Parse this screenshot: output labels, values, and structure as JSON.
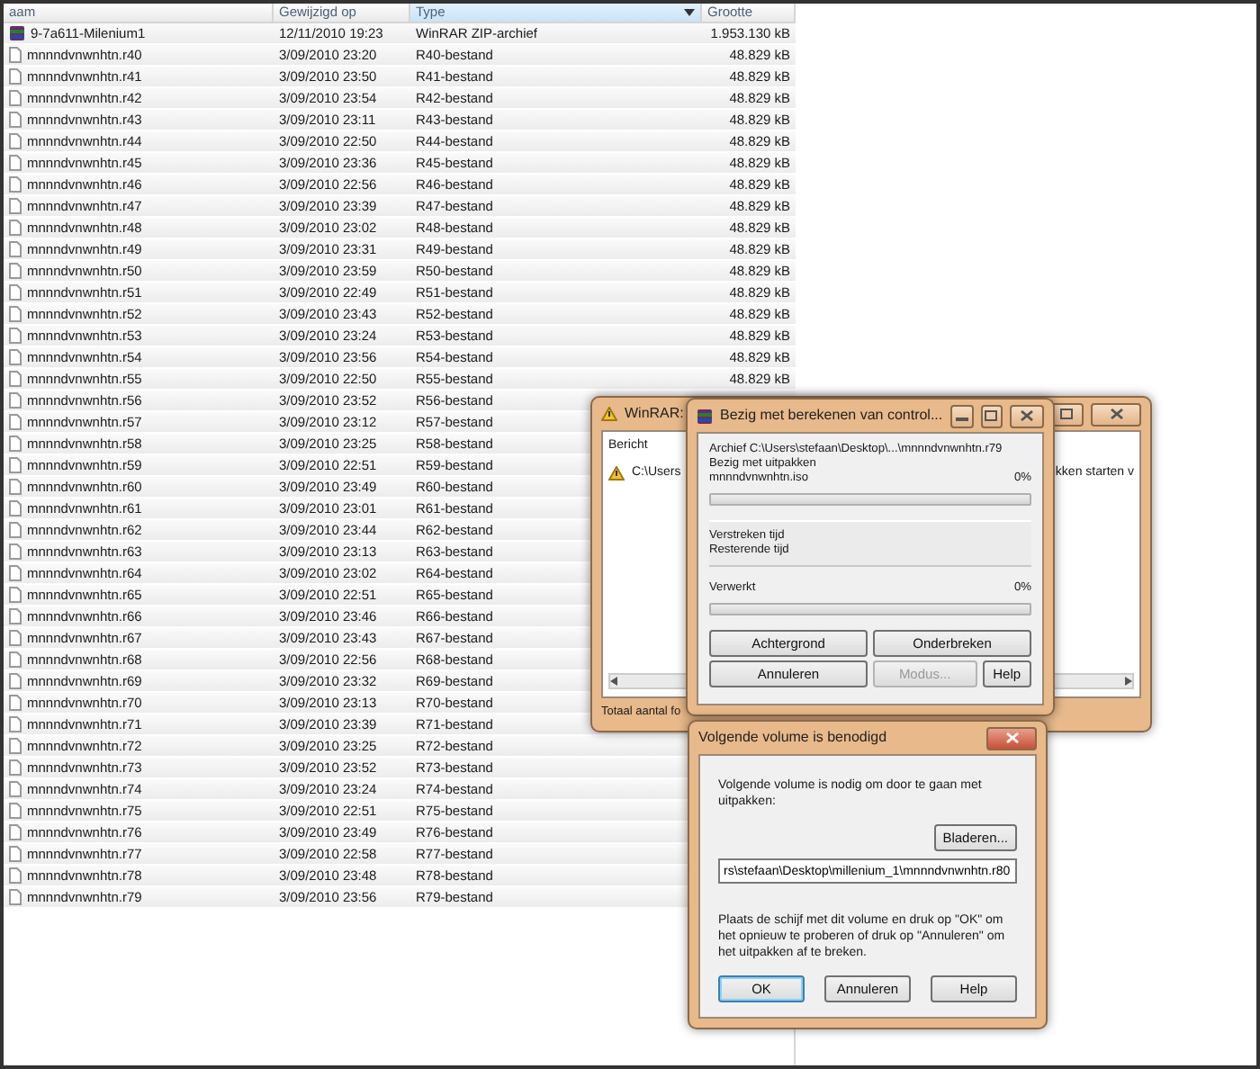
{
  "file_list": {
    "columns": [
      {
        "label": "aam",
        "sorted": false
      },
      {
        "label": "Gewijzigd op",
        "sorted": false
      },
      {
        "label": "Type",
        "sorted": true
      },
      {
        "label": "Grootte",
        "sorted": false
      }
    ],
    "rows": [
      {
        "kind": "archive",
        "name": "9-7a611-Milenium1",
        "modified": "12/11/2010 19:23",
        "type": "WinRAR ZIP-archief",
        "size": "1.953.130 kB"
      },
      {
        "kind": "file",
        "name": "mnnndvnwnhtn.r40",
        "modified": "3/09/2010 23:20",
        "type": "R40-bestand",
        "size": "48.829 kB"
      },
      {
        "kind": "file",
        "name": "mnnndvnwnhtn.r41",
        "modified": "3/09/2010 23:50",
        "type": "R41-bestand",
        "size": "48.829 kB"
      },
      {
        "kind": "file",
        "name": "mnnndvnwnhtn.r42",
        "modified": "3/09/2010 23:54",
        "type": "R42-bestand",
        "size": "48.829 kB"
      },
      {
        "kind": "file",
        "name": "mnnndvnwnhtn.r43",
        "modified": "3/09/2010 23:11",
        "type": "R43-bestand",
        "size": "48.829 kB"
      },
      {
        "kind": "file",
        "name": "mnnndvnwnhtn.r44",
        "modified": "3/09/2010 22:50",
        "type": "R44-bestand",
        "size": "48.829 kB"
      },
      {
        "kind": "file",
        "name": "mnnndvnwnhtn.r45",
        "modified": "3/09/2010 23:36",
        "type": "R45-bestand",
        "size": "48.829 kB"
      },
      {
        "kind": "file",
        "name": "mnnndvnwnhtn.r46",
        "modified": "3/09/2010 22:56",
        "type": "R46-bestand",
        "size": "48.829 kB"
      },
      {
        "kind": "file",
        "name": "mnnndvnwnhtn.r47",
        "modified": "3/09/2010 23:39",
        "type": "R47-bestand",
        "size": "48.829 kB"
      },
      {
        "kind": "file",
        "name": "mnnndvnwnhtn.r48",
        "modified": "3/09/2010 23:02",
        "type": "R48-bestand",
        "size": "48.829 kB"
      },
      {
        "kind": "file",
        "name": "mnnndvnwnhtn.r49",
        "modified": "3/09/2010 23:31",
        "type": "R49-bestand",
        "size": "48.829 kB"
      },
      {
        "kind": "file",
        "name": "mnnndvnwnhtn.r50",
        "modified": "3/09/2010 23:59",
        "type": "R50-bestand",
        "size": "48.829 kB"
      },
      {
        "kind": "file",
        "name": "mnnndvnwnhtn.r51",
        "modified": "3/09/2010 22:49",
        "type": "R51-bestand",
        "size": "48.829 kB"
      },
      {
        "kind": "file",
        "name": "mnnndvnwnhtn.r52",
        "modified": "3/09/2010 23:43",
        "type": "R52-bestand",
        "size": "48.829 kB"
      },
      {
        "kind": "file",
        "name": "mnnndvnwnhtn.r53",
        "modified": "3/09/2010 23:24",
        "type": "R53-bestand",
        "size": "48.829 kB"
      },
      {
        "kind": "file",
        "name": "mnnndvnwnhtn.r54",
        "modified": "3/09/2010 23:56",
        "type": "R54-bestand",
        "size": "48.829 kB"
      },
      {
        "kind": "file",
        "name": "mnnndvnwnhtn.r55",
        "modified": "3/09/2010 22:50",
        "type": "R55-bestand",
        "size": "48.829 kB"
      },
      {
        "kind": "file",
        "name": "mnnndvnwnhtn.r56",
        "modified": "3/09/2010 23:52",
        "type": "R56-bestand"
      },
      {
        "kind": "file",
        "name": "mnnndvnwnhtn.r57",
        "modified": "3/09/2010 23:12",
        "type": "R57-bestand"
      },
      {
        "kind": "file",
        "name": "mnnndvnwnhtn.r58",
        "modified": "3/09/2010 23:25",
        "type": "R58-bestand"
      },
      {
        "kind": "file",
        "name": "mnnndvnwnhtn.r59",
        "modified": "3/09/2010 22:51",
        "type": "R59-bestand"
      },
      {
        "kind": "file",
        "name": "mnnndvnwnhtn.r60",
        "modified": "3/09/2010 23:49",
        "type": "R60-bestand"
      },
      {
        "kind": "file",
        "name": "mnnndvnwnhtn.r61",
        "modified": "3/09/2010 23:01",
        "type": "R61-bestand"
      },
      {
        "kind": "file",
        "name": "mnnndvnwnhtn.r62",
        "modified": "3/09/2010 23:44",
        "type": "R62-bestand"
      },
      {
        "kind": "file",
        "name": "mnnndvnwnhtn.r63",
        "modified": "3/09/2010 23:13",
        "type": "R63-bestand"
      },
      {
        "kind": "file",
        "name": "mnnndvnwnhtn.r64",
        "modified": "3/09/2010 23:02",
        "type": "R64-bestand"
      },
      {
        "kind": "file",
        "name": "mnnndvnwnhtn.r65",
        "modified": "3/09/2010 22:51",
        "type": "R65-bestand"
      },
      {
        "kind": "file",
        "name": "mnnndvnwnhtn.r66",
        "modified": "3/09/2010 23:46",
        "type": "R66-bestand"
      },
      {
        "kind": "file",
        "name": "mnnndvnwnhtn.r67",
        "modified": "3/09/2010 23:43",
        "type": "R67-bestand"
      },
      {
        "kind": "file",
        "name": "mnnndvnwnhtn.r68",
        "modified": "3/09/2010 22:56",
        "type": "R68-bestand"
      },
      {
        "kind": "file",
        "name": "mnnndvnwnhtn.r69",
        "modified": "3/09/2010 23:32",
        "type": "R69-bestand"
      },
      {
        "kind": "file",
        "name": "mnnndvnwnhtn.r70",
        "modified": "3/09/2010 23:13",
        "type": "R70-bestand"
      },
      {
        "kind": "file",
        "name": "mnnndvnwnhtn.r71",
        "modified": "3/09/2010 23:39",
        "type": "R71-bestand"
      },
      {
        "kind": "file",
        "name": "mnnndvnwnhtn.r72",
        "modified": "3/09/2010 23:25",
        "type": "R72-bestand"
      },
      {
        "kind": "file",
        "name": "mnnndvnwnhtn.r73",
        "modified": "3/09/2010 23:52",
        "type": "R73-bestand"
      },
      {
        "kind": "file",
        "name": "mnnndvnwnhtn.r74",
        "modified": "3/09/2010 23:24",
        "type": "R74-bestand"
      },
      {
        "kind": "file",
        "name": "mnnndvnwnhtn.r75",
        "modified": "3/09/2010 22:51",
        "type": "R75-bestand"
      },
      {
        "kind": "file",
        "name": "mnnndvnwnhtn.r76",
        "modified": "3/09/2010 23:49",
        "type": "R76-bestand"
      },
      {
        "kind": "file",
        "name": "mnnndvnwnhtn.r77",
        "modified": "3/09/2010 22:58",
        "type": "R77-bestand"
      },
      {
        "kind": "file",
        "name": "mnnndvnwnhtn.r78",
        "modified": "3/09/2010 23:48",
        "type": "R78-bestand"
      },
      {
        "kind": "file",
        "name": "mnnndvnwnhtn.r79",
        "modified": "3/09/2010 23:56",
        "type": "R79-bestand"
      }
    ]
  },
  "background_window": {
    "title": "WinRAR:",
    "list_header": "Bericht",
    "message_start": "C:\\Users",
    "message_end": "kken starten v",
    "status": "Totaal aantal fo"
  },
  "progress_window": {
    "title": "Bezig met berekenen van control...",
    "archive": "Archief C:\\Users\\stefaan\\Desktop\\...\\mnnndvnwnhtn.r79",
    "action": "Bezig met uitpakken",
    "file": "mnnndvnwnhtn.iso",
    "file_percent": "0%",
    "file_progress": {
      "level": 0
    },
    "elapsed_label": "Verstreken tijd",
    "remaining_label": "Resterende tijd",
    "processed_label": "Verwerkt",
    "processed_percent": "0%",
    "total_progress": {
      "level": 0
    },
    "buttons": [
      {
        "label": "Achtergrond",
        "disabled": false
      },
      {
        "label": "Onderbreken",
        "disabled": false
      },
      {
        "label": "Annuleren",
        "disabled": false
      },
      {
        "label": "Modus...",
        "disabled": true
      },
      {
        "label": "Help",
        "disabled": false
      }
    ]
  },
  "volume_dialog": {
    "title": "Volgende volume is benodigd",
    "prompt": "Volgende volume is nodig om door te gaan met uitpakken:",
    "browse_button": "Bladeren...",
    "path": "rs\\stefaan\\Desktop\\millenium_1\\mnnndvnwnhtn.r80",
    "instructions": "Plaats de schijf met dit volume en druk op \"OK\" om het opnieuw te proberen of druk op \"Annuleren\" om het uitpakken af te breken.",
    "buttons": [
      {
        "label": "OK",
        "default": true
      },
      {
        "label": "Annuleren",
        "default": false
      },
      {
        "label": "Help",
        "default": false
      }
    ]
  }
}
